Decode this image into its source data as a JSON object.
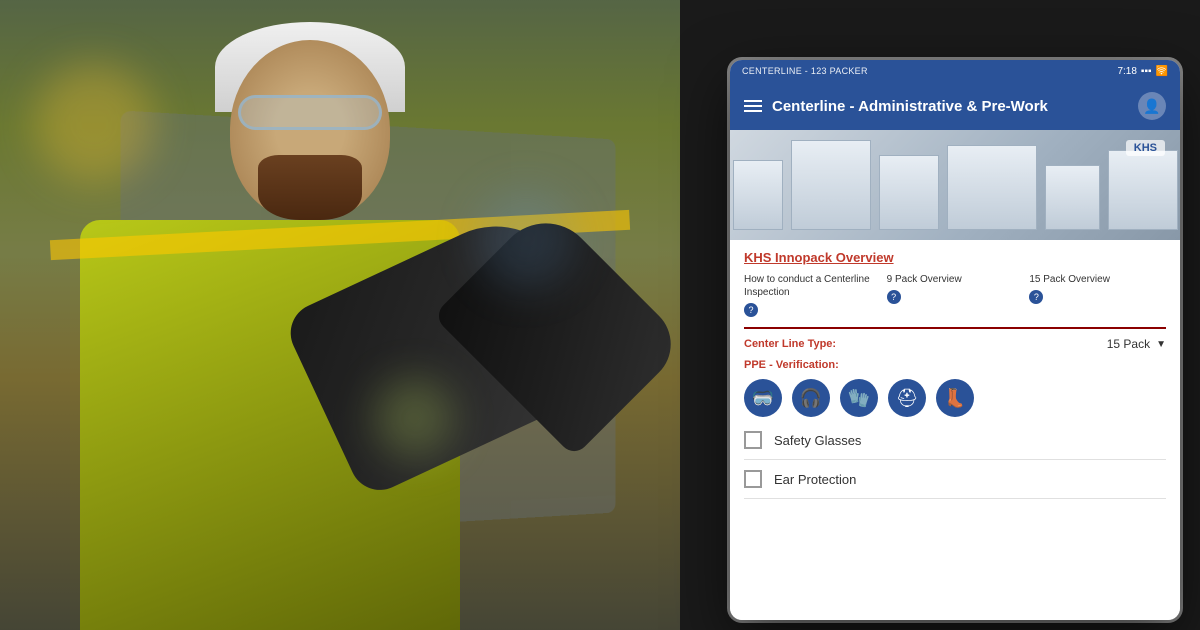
{
  "background": {
    "alt": "Industrial worker wearing safety glasses and hi-vis vest"
  },
  "statusBar": {
    "left": "CENTERLINE - 123 PACKER",
    "time": "7:18",
    "icons": [
      "signal",
      "wifi"
    ]
  },
  "header": {
    "title": "Centerline - Administrative & Pre-Work",
    "menuIcon": "≡",
    "avatarIcon": "person"
  },
  "machineImage": {
    "logo": "KHS",
    "alt": "KHS Innopack industrial packaging machine"
  },
  "sectionLink": "KHS Innopack Overview",
  "subLinks": [
    {
      "text": "How to conduct a Centerline Inspection",
      "badgeLabel": "?"
    },
    {
      "text": "9 Pack Overview",
      "badgeLabel": "?"
    },
    {
      "text": "15 Pack Overview",
      "badgeLabel": "?"
    }
  ],
  "centerLineType": {
    "label": "Center Line Type:",
    "value": "15 Pack"
  },
  "ppeSection": {
    "label": "PPE - Verification:",
    "icons": [
      {
        "name": "safety-glasses-icon",
        "symbol": "👓",
        "title": "Safety Glasses"
      },
      {
        "name": "ear-protection-icon",
        "symbol": "🎧",
        "title": "Ear Protection"
      },
      {
        "name": "gloves-icon",
        "symbol": "🧤",
        "title": "Gloves"
      },
      {
        "name": "hard-hat-icon",
        "symbol": "⛑",
        "title": "Hard Hat"
      },
      {
        "name": "safety-boots-icon",
        "symbol": "👢",
        "title": "Safety Boots"
      }
    ]
  },
  "checklistItems": [
    {
      "id": "item-1",
      "label": "Safety Glasses",
      "checked": false
    },
    {
      "id": "item-2",
      "label": "Ear Protection",
      "checked": false
    }
  ]
}
